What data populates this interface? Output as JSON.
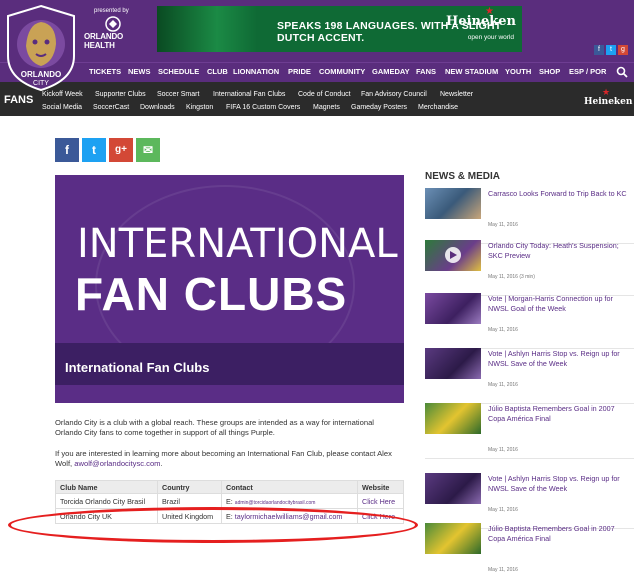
{
  "header": {
    "logo_text": "ORLANDO CITY",
    "presented_by": "presented by",
    "sponsor": "ORLANDO HEALTH",
    "ad_tagline": "SPEAKS 198 LANGUAGES. WITH A SLIGHT DUTCH ACCENT.",
    "ad_brand": "Heineken",
    "ad_sub": "open your world"
  },
  "main_nav": [
    "TICKETS",
    "NEWS",
    "SCHEDULE",
    "CLUB",
    "LIONNATION",
    "PRIDE",
    "COMMUNITY",
    "GAMEDAY",
    "FANS",
    "NEW STADIUM",
    "YOUTH",
    "SHOP",
    "ESP / POR"
  ],
  "fans_bar": {
    "label": "FANS",
    "row1": [
      "Kickoff Week",
      "Supporter Clubs",
      "Soccer Smart",
      "International Fan Clubs",
      "Code of Conduct",
      "Fan Advisory Council",
      "Newsletter"
    ],
    "row2": [
      "Social Media",
      "SoccerCast",
      "Downloads",
      "Kingston",
      "FIFA 16 Custom Covers",
      "Magnets",
      "Gameday Posters",
      "Merchandise"
    ],
    "sponsor": "Heineken"
  },
  "share": [
    "f",
    "t",
    "g+",
    "✉"
  ],
  "hero": {
    "line1": "INTERNATIONAL",
    "line2": "FAN CLUBS",
    "caption": "International Fan Clubs"
  },
  "body": {
    "para1": "Orlando City is a club with a global reach. These groups are intended as a way for international Orlando City fans to come together in support of all things Purple.",
    "para2_prefix": "If you are interested in learning more about becoming an International Fan Club, please contact Alex Wolf, ",
    "para2_email": "awolf@orlandocitysc.com",
    "para2_suffix": "."
  },
  "table": {
    "headers": [
      "Club Name",
      "Country",
      "Contact",
      "Website"
    ],
    "rows": [
      {
        "club": "Torcida Orlando City Brasil",
        "country": "Brazil",
        "contact_prefix": "E: ",
        "email": "admin@torcidaorlandocitybrasil.com",
        "website": "Click Here"
      },
      {
        "club": "Orlando City UK",
        "country": "United Kingdom",
        "contact_prefix": "E: ",
        "email": "taylormichaelwilliams@gmail.com",
        "website": "Click Here"
      }
    ]
  },
  "sidebar": {
    "title": "NEWS & MEDIA",
    "items": [
      {
        "headline": "Carrasco Looks Forward to Trip Back to KC",
        "date": "May 11, 2016"
      },
      {
        "headline": "Orlando City Today: Heath's Suspension; SKC Preview",
        "date": "May 11, 2016 (3 min)"
      },
      {
        "headline": "Vote | Morgan-Harris Connection up for NWSL Goal of the Week",
        "date": "May 11, 2016"
      },
      {
        "headline": "Vote | Ashlyn Harris Stop vs. Reign up for NWSL Save of the Week",
        "date": "May 11, 2016"
      },
      {
        "headline": "Júlio Baptista Remembers Goal in 2007 Copa América Final",
        "date": "May 11, 2016"
      },
      {
        "headline": "Vote | Ashlyn Harris Stop vs. Reign up for NWSL Save of the Week",
        "date": "May 11, 2016"
      },
      {
        "headline": "Júlio Baptista Remembers Goal in 2007 Copa América Final",
        "date": "May 11, 2016"
      }
    ]
  },
  "colors": {
    "purple": "#5a2d7d",
    "dark_bar": "#2b2b2b",
    "link": "#5a2d86",
    "highlight": "#e51f1f"
  }
}
